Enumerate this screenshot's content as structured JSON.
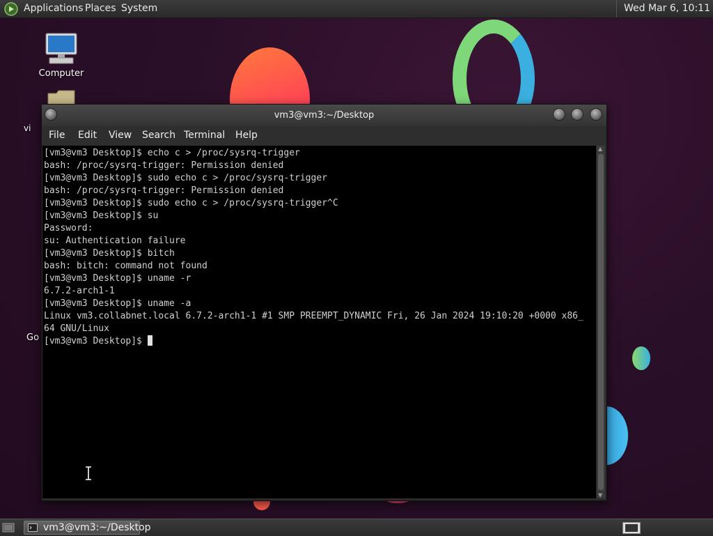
{
  "top_panel": {
    "menus": [
      "Applications",
      "Places",
      "System"
    ],
    "clock": "Wed Mar  6, 10:11"
  },
  "desktop": {
    "icons": [
      {
        "label": "Computer",
        "icon": "computer-icon"
      },
      {
        "label": "vi",
        "icon": "folder-icon"
      },
      {
        "label": "Go",
        "icon": "trash-icon"
      }
    ]
  },
  "window": {
    "title": "vm3@vm3:~/Desktop",
    "menu": [
      "File",
      "Edit",
      "View",
      "Search",
      "Terminal",
      "Help"
    ],
    "lines": [
      "[vm3@vm3 Desktop]$ echo c > /proc/sysrq-trigger",
      "bash: /proc/sysrq-trigger: Permission denied",
      "[vm3@vm3 Desktop]$ sudo echo c > /proc/sysrq-trigger",
      "bash: /proc/sysrq-trigger: Permission denied",
      "[vm3@vm3 Desktop]$ sudo echo c > /proc/sysrq-trigger^C",
      "[vm3@vm3 Desktop]$ su",
      "Password:",
      "su: Authentication failure",
      "[vm3@vm3 Desktop]$ bitch",
      "bash: bitch: command not found",
      "[vm3@vm3 Desktop]$ uname -r",
      "6.7.2-arch1-1",
      "[vm3@vm3 Desktop]$ uname -a",
      "Linux vm3.collabnet.local 6.7.2-arch1-1 #1 SMP PREEMPT_DYNAMIC Fri, 26 Jan 2024 19:10:20 +0000 x86_",
      "64 GNU/Linux"
    ],
    "prompt": "[vm3@vm3 Desktop]$ "
  },
  "taskbar": {
    "task_label": "vm3@vm3:~/Desktop"
  }
}
